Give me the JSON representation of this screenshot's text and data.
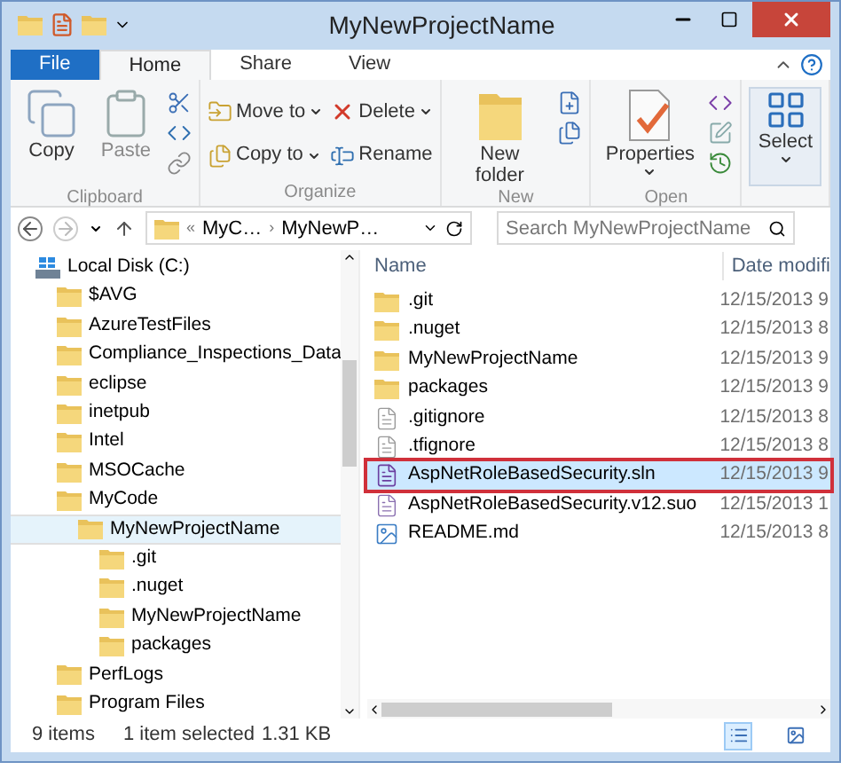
{
  "window": {
    "title": "MyNewProjectName"
  },
  "tabs": [
    {
      "label": "File",
      "kind": "file",
      "selected": false
    },
    {
      "label": "Home",
      "kind": "tab",
      "selected": true
    },
    {
      "label": "Share",
      "kind": "tab",
      "selected": false
    },
    {
      "label": "View",
      "kind": "tab",
      "selected": false
    }
  ],
  "ribbon": {
    "groups": [
      {
        "label": "Clipboard",
        "items": [
          {
            "kind": "big",
            "label": "Copy",
            "disabled": false
          },
          {
            "kind": "big",
            "label": "Paste",
            "disabled": true
          }
        ]
      },
      {
        "label": "Organize",
        "items": [
          {
            "kind": "stack",
            "entries": [
              {
                "label": "Move to",
                "dropdown": true
              },
              {
                "label": "Copy to",
                "dropdown": true
              }
            ]
          },
          {
            "kind": "stack",
            "entries": [
              {
                "label": "Delete",
                "dropdown": true
              },
              {
                "label": "Rename",
                "dropdown": false
              }
            ]
          }
        ]
      },
      {
        "label": "New",
        "items": [
          {
            "kind": "big",
            "label": "New folder",
            "disabled": false,
            "dropdown": false
          }
        ]
      },
      {
        "label": "Open",
        "items": [
          {
            "kind": "big",
            "label": "Properties",
            "disabled": false,
            "dropdown": true
          }
        ]
      },
      {
        "items": [
          {
            "kind": "big",
            "label": "Select",
            "disabled": false,
            "dropdown": true,
            "selected": true
          }
        ]
      }
    ]
  },
  "address": {
    "path": [
      {
        "separator": "«",
        "label": "MyC…"
      },
      {
        "separator": "›",
        "label": "MyNewP…"
      }
    ],
    "search_placeholder": "Search MyNewProjectName"
  },
  "tree": [
    {
      "label": "Local Disk (C:)",
      "kind": "drive",
      "selected": false,
      "children": [
        {
          "label": "$AVG",
          "kind": "folder",
          "selected": false
        },
        {
          "label": "AzureTestFiles",
          "kind": "folder",
          "selected": false
        },
        {
          "label": "Compliance_Inspections_Data",
          "kind": "folder",
          "selected": false
        },
        {
          "label": "eclipse",
          "kind": "folder",
          "selected": false
        },
        {
          "label": "inetpub",
          "kind": "folder",
          "selected": false
        },
        {
          "label": "Intel",
          "kind": "folder",
          "selected": false
        },
        {
          "label": "MSOCache",
          "kind": "folder",
          "selected": false
        },
        {
          "label": "MyCode",
          "kind": "folder",
          "selected": false,
          "children": [
            {
              "label": "MyNewProjectName",
              "kind": "folder",
              "selected": true,
              "children": [
                {
                  "label": ".git",
                  "kind": "folder",
                  "selected": false
                },
                {
                  "label": ".nuget",
                  "kind": "folder",
                  "selected": false
                },
                {
                  "label": "MyNewProjectName",
                  "kind": "folder",
                  "selected": false
                },
                {
                  "label": "packages",
                  "kind": "folder",
                  "selected": false
                }
              ]
            }
          ]
        },
        {
          "label": "PerfLogs",
          "kind": "folder",
          "selected": false
        },
        {
          "label": "Program Files",
          "kind": "folder",
          "selected": false
        }
      ]
    }
  ],
  "files": {
    "columns": [
      "Name",
      "Date modifi"
    ],
    "rows": [
      {
        "name": ".git",
        "date": "12/15/2013 9",
        "kind": "folder",
        "selected": false,
        "outlined": false
      },
      {
        "name": ".nuget",
        "date": "12/15/2013 8",
        "kind": "folder",
        "selected": false,
        "outlined": false
      },
      {
        "name": "MyNewProjectName",
        "date": "12/15/2013 9",
        "kind": "folder",
        "selected": false,
        "outlined": false
      },
      {
        "name": "packages",
        "date": "12/15/2013 9",
        "kind": "folder",
        "selected": false,
        "outlined": false
      },
      {
        "name": ".gitignore",
        "date": "12/15/2013 8",
        "kind": "file",
        "selected": false,
        "outlined": false
      },
      {
        "name": ".tfignore",
        "date": "12/15/2013 8",
        "kind": "file",
        "selected": false,
        "outlined": false
      },
      {
        "name": "AspNetRoleBasedSecurity.sln",
        "date": "12/15/2013 9",
        "kind": "sln",
        "selected": true,
        "outlined": true
      },
      {
        "name": "AspNetRoleBasedSecurity.v12.suo",
        "date": "12/15/2013 1",
        "kind": "suo",
        "selected": false,
        "outlined": false
      },
      {
        "name": "README.md",
        "date": "12/15/2013 8",
        "kind": "md",
        "selected": false,
        "outlined": false
      }
    ]
  },
  "status_bar": {
    "count": "9 items",
    "selection": "1 item selected",
    "size": "1.31 KB"
  },
  "view_buttons": [
    {
      "kind": "details",
      "selected": true
    },
    {
      "kind": "tiles",
      "selected": false
    }
  ]
}
